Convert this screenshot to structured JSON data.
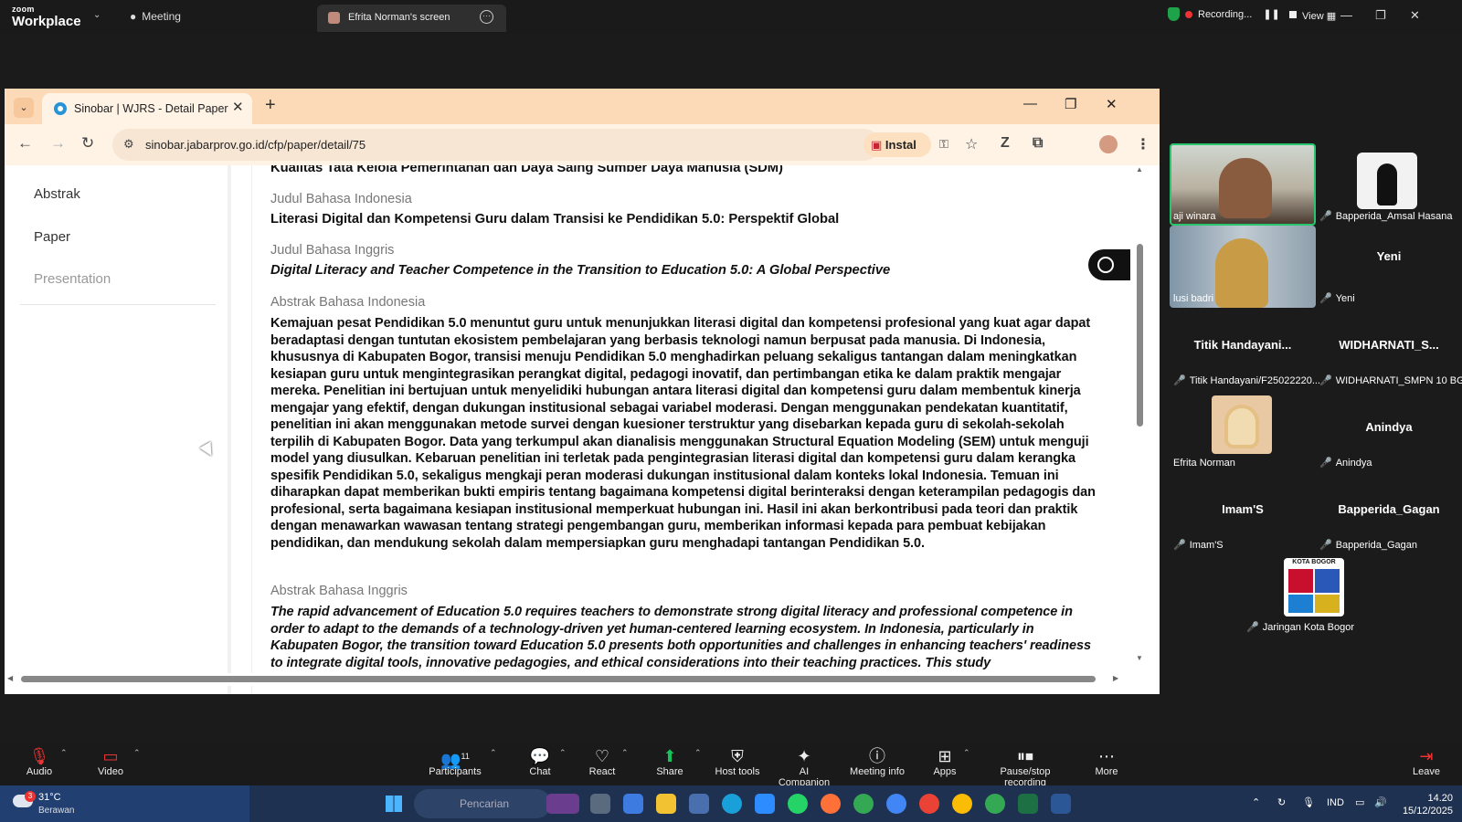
{
  "zoom": {
    "logo_line1": "zoom",
    "logo_line2": "Workplace",
    "meeting_label": "Meeting",
    "screen_tab_label": "Efrita Norman's screen",
    "recording_label": "Recording...",
    "view_label": "View"
  },
  "browser": {
    "tab_title": "Sinobar | WJRS - Detail Paper",
    "url": "sinobar.jabarprov.go.id/cfp/paper/detail/75",
    "install_label": "Instal"
  },
  "sidenav": {
    "items": [
      "Abstrak",
      "Paper",
      "Presentation"
    ]
  },
  "paper": {
    "top_cut_text": "Kualitas Tata Kelola Pemerintahan dan Daya Saing Sumber Daya Manusia (SDM)",
    "judul_id_label": "Judul Bahasa Indonesia",
    "judul_id": "Literasi Digital dan Kompetensi Guru dalam Transisi ke Pendidikan 5.0: Perspektif Global",
    "judul_en_label": "Judul Bahasa Inggris",
    "judul_en": "Digital Literacy and Teacher Competence in the Transition to Education 5.0: A Global Perspective",
    "abstrak_id_label": "Abstrak Bahasa Indonesia",
    "abstrak_id": "Kemajuan pesat Pendidikan 5.0 menuntut guru untuk menunjukkan literasi digital dan kompetensi profesional yang kuat agar dapat beradaptasi dengan tuntutan ekosistem pembelajaran yang berbasis teknologi namun berpusat pada manusia. Di Indonesia, khususnya di Kabupaten Bogor, transisi menuju Pendidikan 5.0 menghadirkan peluang sekaligus tantangan dalam meningkatkan kesiapan guru untuk mengintegrasikan perangkat digital, pedagogi inovatif, dan pertimbangan etika ke dalam praktik mengajar mereka. Penelitian ini bertujuan untuk menyelidiki hubungan antara literasi digital dan kompetensi guru dalam membentuk kinerja mengajar yang efektif, dengan dukungan institusional sebagai variabel moderasi. Dengan menggunakan pendekatan kuantitatif, penelitian ini akan menggunakan metode survei dengan kuesioner terstruktur yang disebarkan kepada guru di sekolah-sekolah terpilih di Kabupaten Bogor. Data yang terkumpul akan dianalisis menggunakan Structural Equation Modeling (SEM) untuk menguji model yang diusulkan. Kebaruan penelitian ini terletak pada pengintegrasian literasi digital dan kompetensi guru dalam kerangka spesifik Pendidikan 5.0, sekaligus mengkaji peran moderasi dukungan institusional dalam konteks lokal Indonesia. Temuan ini diharapkan dapat memberikan bukti empiris tentang bagaimana kompetensi digital berinteraksi dengan keterampilan pedagogis dan profesional, serta bagaimana kesiapan institusional memperkuat hubungan ini. Hasil ini akan berkontribusi pada teori dan praktik dengan menawarkan wawasan tentang strategi pengembangan guru, memberikan informasi kepada para pembuat kebijakan pendidikan, dan mendukung sekolah dalam mempersiapkan guru menghadapi tantangan Pendidikan 5.0.",
    "abstrak_en_label": "Abstrak Bahasa Inggris",
    "abstrak_en": "The rapid advancement of Education 5.0 requires teachers to demonstrate strong digital literacy and professional competence in order to adapt to the demands of a technology-driven yet human-centered learning ecosystem. In Indonesia, particularly in Kabupaten Bogor, the transition toward Education 5.0 presents both opportunities and challenges in enhancing teachers' readiness to integrate digital tools, innovative pedagogies, and ethical considerations into their teaching practices. This study"
  },
  "participants": {
    "tiles": [
      {
        "center": "",
        "tag": "aji winara",
        "muted": false
      },
      {
        "center": "",
        "tag": "Bapperida_Amsal Hasana",
        "muted": true
      },
      {
        "center": "",
        "tag": "lusi badri",
        "muted": false
      },
      {
        "center": "Yeni",
        "tag": "Yeni",
        "muted": true
      },
      {
        "center": "Titik  Handayani...",
        "tag": "Titik Handayani/F25022220...",
        "muted": true
      },
      {
        "center": "WIDHARNATI_S...",
        "tag": "WIDHARNATI_SMPN 10 BGR",
        "muted": true
      },
      {
        "center": "",
        "tag": "Efrita Norman",
        "muted": false
      },
      {
        "center": "Anindya",
        "tag": "Anindya",
        "muted": true
      },
      {
        "center": "Imam'S",
        "tag": "Imam'S",
        "muted": true
      },
      {
        "center": "Bapperida_Gagan",
        "tag": "Bapperida_Gagan",
        "muted": true
      },
      {
        "center": "",
        "tag": "Jaringan Kota Bogor",
        "muted": true
      }
    ],
    "logo_text": "KOTA BOGOR"
  },
  "toolbar": {
    "audio": "Audio",
    "video": "Video",
    "participants": "Participants",
    "participants_count": "11",
    "chat": "Chat",
    "react": "React",
    "share": "Share",
    "host_tools": "Host tools",
    "ai_companion": "AI Companion",
    "meeting_info": "Meeting info",
    "apps": "Apps",
    "pause_rec": "Pause/stop recording",
    "more": "More",
    "leave": "Leave"
  },
  "taskbar": {
    "weather_temp": "31°C",
    "weather_desc": "Berawan",
    "weather_badge": "3",
    "search_placeholder": "Pencarian",
    "lang": "IND",
    "time": "14.20",
    "date": "15/12/2025"
  },
  "colors": {
    "browser_tabbar": "#fcd9b7",
    "active_speaker_border": "#28c76f",
    "mic_off": "#e33333",
    "share_green": "#18c25a"
  }
}
